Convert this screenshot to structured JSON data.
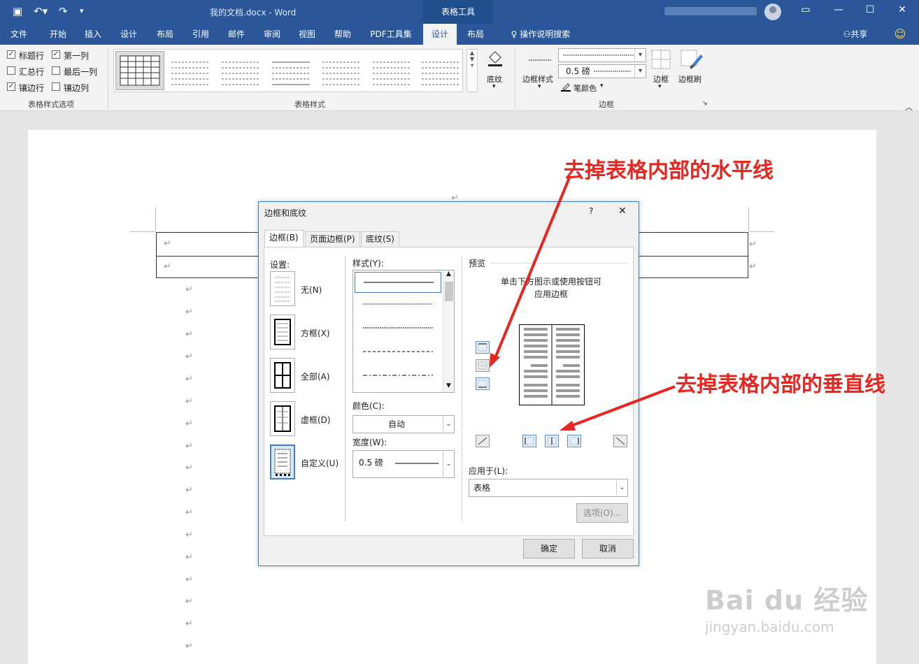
{
  "title_bar": {
    "document_title": "我的文档.docx  -  Word",
    "context_tab": "表格工具",
    "undo_icon": "undo-icon",
    "redo_icon": "redo-icon",
    "save_icon": "save-icon"
  },
  "ribbon_tabs": [
    "文件",
    "开始",
    "插入",
    "设计",
    "布局",
    "引用",
    "邮件",
    "审阅",
    "视图",
    "帮助",
    "PDF工具集",
    "设计",
    "布局"
  ],
  "active_tab": "设计",
  "tell_me": "操作说明搜索",
  "share": "共享",
  "table_style_options": {
    "items": [
      {
        "label": "标题行",
        "checked": true
      },
      {
        "label": "第一列",
        "checked": true
      },
      {
        "label": "汇总行",
        "checked": false
      },
      {
        "label": "最后一列",
        "checked": false
      },
      {
        "label": "镶边行",
        "checked": true
      },
      {
        "label": "镶边列",
        "checked": false
      }
    ],
    "group_label": "表格样式选项"
  },
  "table_styles_group": {
    "label": "表格样式",
    "shading": "底纹"
  },
  "borders_group": {
    "label": "边框",
    "border_styles": "边框样式",
    "pen_weight": "0.5 磅",
    "pen_color": "笔颜色",
    "borders": "边框",
    "border_painter": "边框刷"
  },
  "document": {
    "return_mark": "↵"
  },
  "dialog": {
    "title": "边框和底纹",
    "help": "?",
    "close": "✕",
    "tabs": [
      "边框(B)",
      "页面边框(P)",
      "底纹(S)"
    ],
    "setting_label": "设置:",
    "settings": [
      "无(N)",
      "方框(X)",
      "全部(A)",
      "虚框(D)",
      "自定义(U)"
    ],
    "style_label": "样式(Y):",
    "color_label": "颜色(C):",
    "color_value": "自动",
    "width_label": "宽度(W):",
    "width_value": "0.5 磅",
    "preview_label": "预览",
    "preview_hint_1": "单击下方图示或使用按钮可",
    "preview_hint_2": "应用边框",
    "apply_to_label": "应用于(L):",
    "apply_to_value": "表格",
    "options_button": "选项(O)...",
    "ok_button": "确定",
    "cancel_button": "取消"
  },
  "annotations": {
    "horizontal": "去掉表格内部的水平线",
    "vertical": "去掉表格内部的垂直线",
    "color": "#e8251e"
  },
  "watermark": {
    "brand": "Bai du 经验",
    "url": "jingyan.baidu.com"
  }
}
